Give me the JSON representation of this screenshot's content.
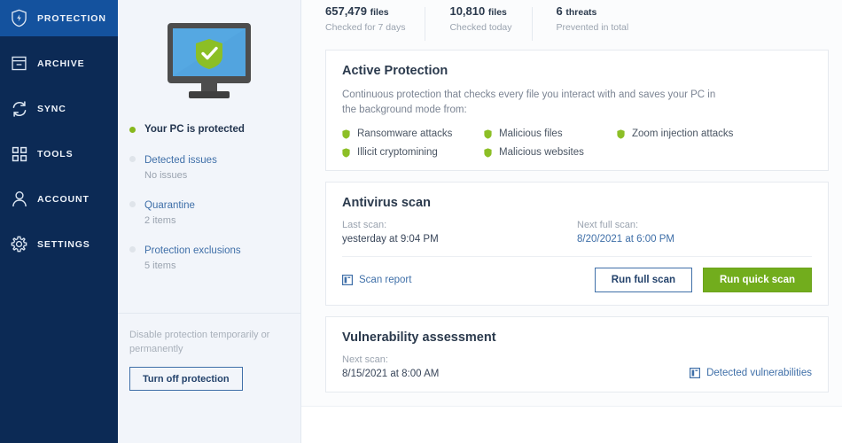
{
  "sidebar": {
    "items": [
      {
        "label": "PROTECTION",
        "icon": "shield-bolt-icon",
        "active": true
      },
      {
        "label": "ARCHIVE",
        "icon": "archive-box-icon",
        "active": false
      },
      {
        "label": "SYNC",
        "icon": "sync-arrows-icon",
        "active": false
      },
      {
        "label": "TOOLS",
        "icon": "grid-squares-icon",
        "active": false
      },
      {
        "label": "ACCOUNT",
        "icon": "person-icon",
        "active": false
      },
      {
        "label": "SETTINGS",
        "icon": "gear-icon",
        "active": false
      }
    ]
  },
  "midpanel": {
    "illustration": "monitor-with-green-shield-icon",
    "status": {
      "title": "Your PC is protected",
      "dot_color": "#87b81d"
    },
    "links": [
      {
        "label": "Detected issues",
        "sub": "No issues"
      },
      {
        "label": "Quarantine",
        "sub": "2 items"
      },
      {
        "label": "Protection exclusions",
        "sub": "5 items"
      }
    ],
    "disable": {
      "text": "Disable protection temporarily or permanently",
      "button_label": "Turn off protection"
    }
  },
  "main": {
    "stats": [
      {
        "value": "657,479",
        "unit": "files",
        "sub": "Checked for 7 days"
      },
      {
        "value": "10,810",
        "unit": "files",
        "sub": "Checked today"
      },
      {
        "value": "6",
        "unit": "threats",
        "sub": "Prevented in total"
      }
    ],
    "active_protection": {
      "title": "Active Protection",
      "description": "Continuous protection that checks every file you interact with and saves your PC in the background mode from:",
      "threats": [
        "Ransomware attacks",
        "Malicious files",
        "Zoom injection attacks",
        "Illicit cryptomining",
        "Malicious websites"
      ]
    },
    "antivirus_scan": {
      "title": "Antivirus scan",
      "last_scan_label": "Last scan:",
      "last_scan_value": "yesterday at 9:04 PM",
      "next_scan_label": "Next full scan:",
      "next_scan_value": "8/20/2021 at 6:00 PM",
      "report_link": "Scan report",
      "report_icon": "report-document-icon",
      "full_scan_button": "Run full scan",
      "quick_scan_button": "Run quick scan"
    },
    "vulnerability": {
      "title": "Vulnerability assessment",
      "next_scan_label": "Next scan:",
      "next_scan_value": "8/15/2021 at 8:00 AM",
      "link_label": "Detected vulnerabilities",
      "link_icon": "report-document-icon"
    }
  },
  "colors": {
    "sidebar_bg": "#0c2a55",
    "sidebar_active": "#14529e",
    "accent_green": "#72ad1d",
    "accent_blue": "#3f6fa8",
    "status_green": "#87b81d"
  }
}
